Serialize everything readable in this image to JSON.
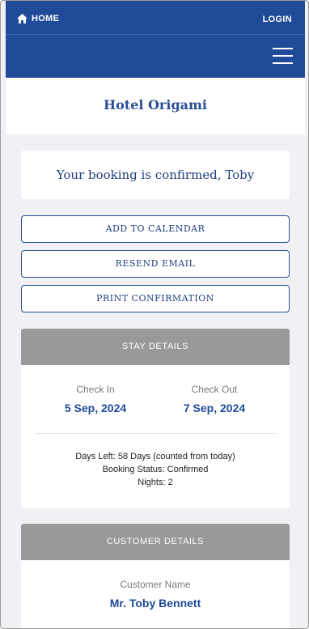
{
  "nav": {
    "home_label": "HOME",
    "login_label": "LOGIN"
  },
  "hotel": {
    "name": "Hotel Origami"
  },
  "confirmation": {
    "message": "Your booking is confirmed, Toby"
  },
  "actions": {
    "add_to_calendar": "ADD TO CALENDAR",
    "resend_email": "RESEND EMAIL",
    "print_confirmation": "PRINT CONFIRMATION"
  },
  "stay": {
    "header": "STAY DETAILS",
    "check_in_label": "Check In",
    "check_in_value": "5 Sep, 2024",
    "check_out_label": "Check Out",
    "check_out_value": "7 Sep, 2024",
    "days_left": "Days Left: 58 Days (counted from today)",
    "booking_status": "Booking Status: Confirmed",
    "nights": "Nights: 2"
  },
  "customer": {
    "header": "CUSTOMER DETAILS",
    "name_label": "Customer Name",
    "name_value": "Mr. Toby Bennett"
  },
  "colors": {
    "brand": "#1f4b99",
    "header_gray": "#999999",
    "page_bg": "#f0f0f5"
  }
}
